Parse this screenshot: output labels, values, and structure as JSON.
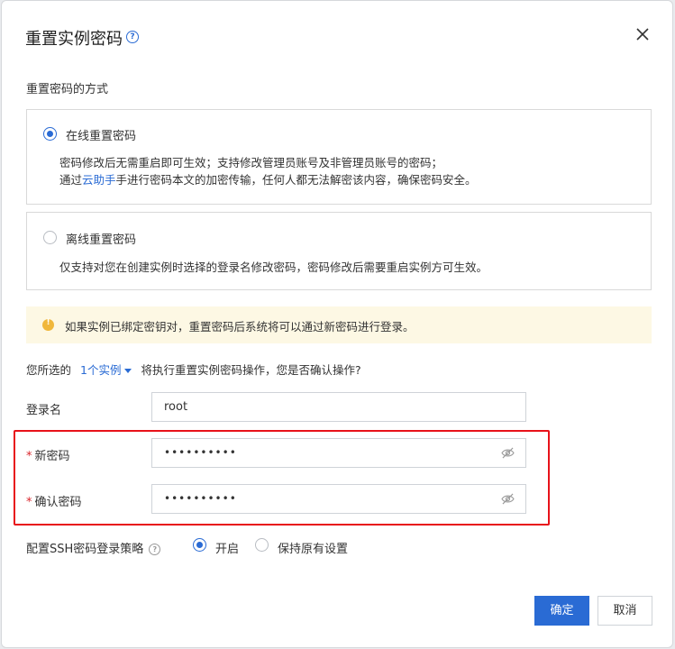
{
  "dialog": {
    "title": "重置实例密码",
    "section_label": "重置密码的方式"
  },
  "options": {
    "online": {
      "title": "在线重置密码",
      "desc1": "密码修改后无需重启即可生效；支持修改管理员账号及非管理员账号的密码；",
      "desc2_pre": "通过",
      "desc2_link": "云助手",
      "desc2_post": "手进行密码本文的加密传输，任何人都无法解密该内容，确保密码安全。",
      "selected": true
    },
    "offline": {
      "title": "离线重置密码",
      "desc1": "仅支持对您在创建实例时选择的登录名修改密码，密码修改后需要重启实例方可生效。",
      "selected": false
    }
  },
  "warning": {
    "text": "如果实例已绑定密钥对，重置密码后系统将可以通过新密码进行登录。"
  },
  "selection": {
    "pre": "您所选的",
    "link": "1个实例",
    "post": "将执行重置实例密码操作，您是否确认操作?"
  },
  "form": {
    "login_label": "登录名",
    "login_value": "root",
    "new_pw_label": "新密码",
    "new_pw_value": "••••••••••",
    "confirm_pw_label": "确认密码",
    "confirm_pw_value": "••••••••••",
    "required_mark": "*"
  },
  "ssh": {
    "label": "配置SSH密码登录策略",
    "opt_on": "开启",
    "opt_keep": "保持原有设置",
    "selected": "开启"
  },
  "buttons": {
    "ok": "确定",
    "cancel": "取消"
  },
  "colors": {
    "accent": "#2a6bd4",
    "warning_bg": "#fdf8e4",
    "highlight": "#e8121a"
  }
}
